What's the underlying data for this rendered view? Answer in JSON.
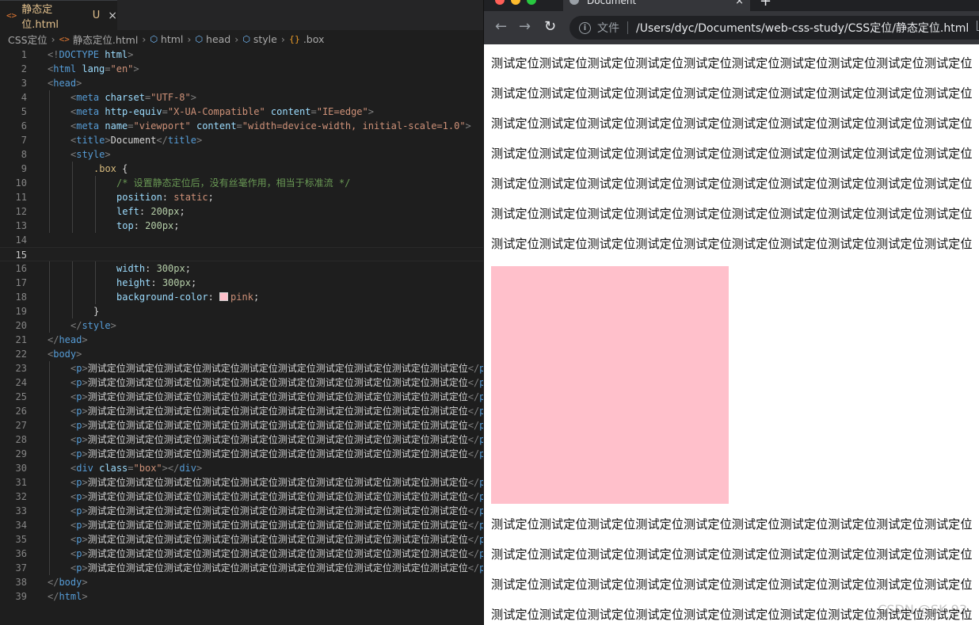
{
  "editor": {
    "tab": {
      "file_icon": "<>",
      "label": "静态定位.html",
      "modified": "U",
      "close": "×"
    },
    "breadcrumb": {
      "folder": "CSS定位",
      "file_icon": "<>",
      "file": "静态定位.html",
      "html": "html",
      "head": "head",
      "style": "style",
      "selector": ".box"
    },
    "active_line": 15,
    "code": {
      "l1": [
        "<!",
        "DOCTYPE",
        " html",
        ">"
      ],
      "l2": [
        "<",
        "html",
        " lang",
        "=",
        "\"en\"",
        ">"
      ],
      "l3": [
        "<",
        "head",
        ">"
      ],
      "l4": [
        "<",
        "meta",
        " charset",
        "=",
        "\"UTF-8\"",
        ">"
      ],
      "l5": [
        "<",
        "meta",
        " http-equiv",
        "=",
        "\"X-UA-Compatible\"",
        " content",
        "=",
        "\"IE=edge\"",
        ">"
      ],
      "l6": [
        "<",
        "meta",
        " name",
        "=",
        "\"viewport\"",
        " content",
        "=",
        "\"width=device-width, initial-scale=1.0\"",
        ">"
      ],
      "l7": [
        "<",
        "title",
        ">",
        "Document",
        "</",
        "title",
        ">"
      ],
      "l8": [
        "<",
        "style",
        ">"
      ],
      "l9": [
        ".box",
        " {"
      ],
      "l10": [
        "/* 设置静态定位后，没有丝毫作用，相当于标准流 */"
      ],
      "l11": [
        "position",
        ": ",
        "static",
        ";"
      ],
      "l12": [
        "left",
        ": ",
        "200px",
        ";"
      ],
      "l13": [
        "top",
        ": ",
        "200px",
        ";"
      ],
      "l16": [
        "width",
        ": ",
        "300px",
        ";"
      ],
      "l17": [
        "height",
        ": ",
        "300px",
        ";"
      ],
      "l18": [
        "background-color",
        ": ",
        "pink",
        ";"
      ],
      "l19": [
        "}"
      ],
      "l20": [
        "</",
        "style",
        ">"
      ],
      "l21": [
        "</",
        "head",
        ">"
      ],
      "l22": [
        "<",
        "body",
        ">"
      ],
      "p_open": [
        "<",
        "p",
        ">"
      ],
      "p_text": "测试定位测试定位测试定位测试定位测试定位测试定位测试定位测试定位测试定位测试定位",
      "p_close": [
        "</",
        "p",
        ">"
      ],
      "l29": [
        "<",
        "div",
        " class",
        "=",
        "\"box\"",
        "></",
        "div",
        ">"
      ],
      "l37": [
        "</",
        "body",
        ">"
      ],
      "l38": [
        "</",
        "html",
        ">"
      ]
    }
  },
  "browser": {
    "tab_title": "Document",
    "tab_close": "×",
    "new_tab": "+",
    "nav": {
      "back": "←",
      "forward": "→",
      "reload": "↻"
    },
    "info_icon": "i",
    "scheme_label": "文件",
    "url": "/Users/dyc/Documents/web-css-study/CSS定位/静态定位.html",
    "paragraph_text": "测试定位测试定位测试定位测试定位测试定位测试定位测试定位测试定位测试定位测试定位",
    "box_color": "#ffc0cb",
    "watermark": "CSDN @SK 93"
  },
  "colors": {
    "editor_bg": "#1e1e1e",
    "tag": "#569cd6",
    "attr": "#9cdcfe",
    "string": "#ce9178",
    "comment": "#6a9955",
    "selector": "#d7ba7d",
    "number": "#b5cea8",
    "browser_chrome": "#35363a"
  }
}
